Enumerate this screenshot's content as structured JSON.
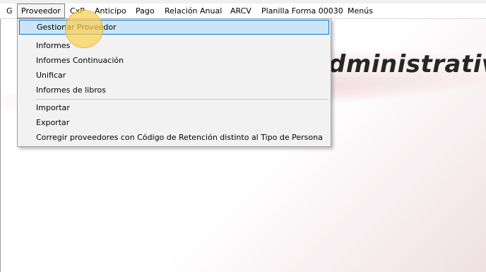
{
  "menubar": {
    "items": [
      {
        "label": "G"
      },
      {
        "label": "Proveedor"
      },
      {
        "label": "CxP"
      },
      {
        "label": "Anticipo"
      },
      {
        "label": "Pago"
      },
      {
        "label": "Relación Anual"
      },
      {
        "label": "ARCV"
      },
      {
        "label": "Planilla Forma 00030"
      },
      {
        "label": "Menús"
      }
    ]
  },
  "dropdown": {
    "items": [
      {
        "label": "Gestionar Proveedor"
      },
      {
        "label": "Informes"
      },
      {
        "label": "Informes Continuación"
      },
      {
        "label": "Unificar"
      },
      {
        "label": "Informes de libros"
      },
      {
        "label": "Importar"
      },
      {
        "label": "Exportar"
      },
      {
        "label": "Corregir proveedores con Código de Retención distinto al Tipo de Persona"
      }
    ]
  },
  "background": {
    "banner_text": "dministrativ"
  },
  "colors": {
    "highlight_bg": "#cce4f7",
    "highlight_border": "#0078d7",
    "cursor": "#fcd050"
  }
}
